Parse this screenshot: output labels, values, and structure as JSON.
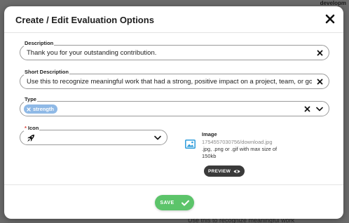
{
  "background": {
    "corner_text": "developm",
    "bottom_text": "Use this to recognize meaningful work"
  },
  "modal": {
    "title": "Create / Edit Evaluation Options",
    "close_icon": "close-icon"
  },
  "fields": {
    "description": {
      "label": "Description",
      "value": "Thank you for your outstanding contribution."
    },
    "short_description": {
      "label": "Short Description",
      "value": "Use this to recognize meaningful work that had a strong, positive impact on a project, team, or goal."
    },
    "type": {
      "label": "Type",
      "selected_tag": "strength"
    },
    "icon": {
      "required_mark": "*",
      "label": "Icon",
      "selected_icon": "rocket-icon"
    }
  },
  "image": {
    "title": "Image",
    "filename": "1754557030756/download.jpg",
    "hint": ".jpg, .png or .gif with max size of 150kb",
    "preview_label": "PREVIEW"
  },
  "footer": {
    "save_label": "SAVE"
  },
  "colors": {
    "accent_green": "#5cc46a",
    "chip_blue": "#8fb9e6",
    "image_icon_blue": "#2d9cdb",
    "dark_button": "#3a3a3a",
    "required_red": "#d9382f"
  }
}
